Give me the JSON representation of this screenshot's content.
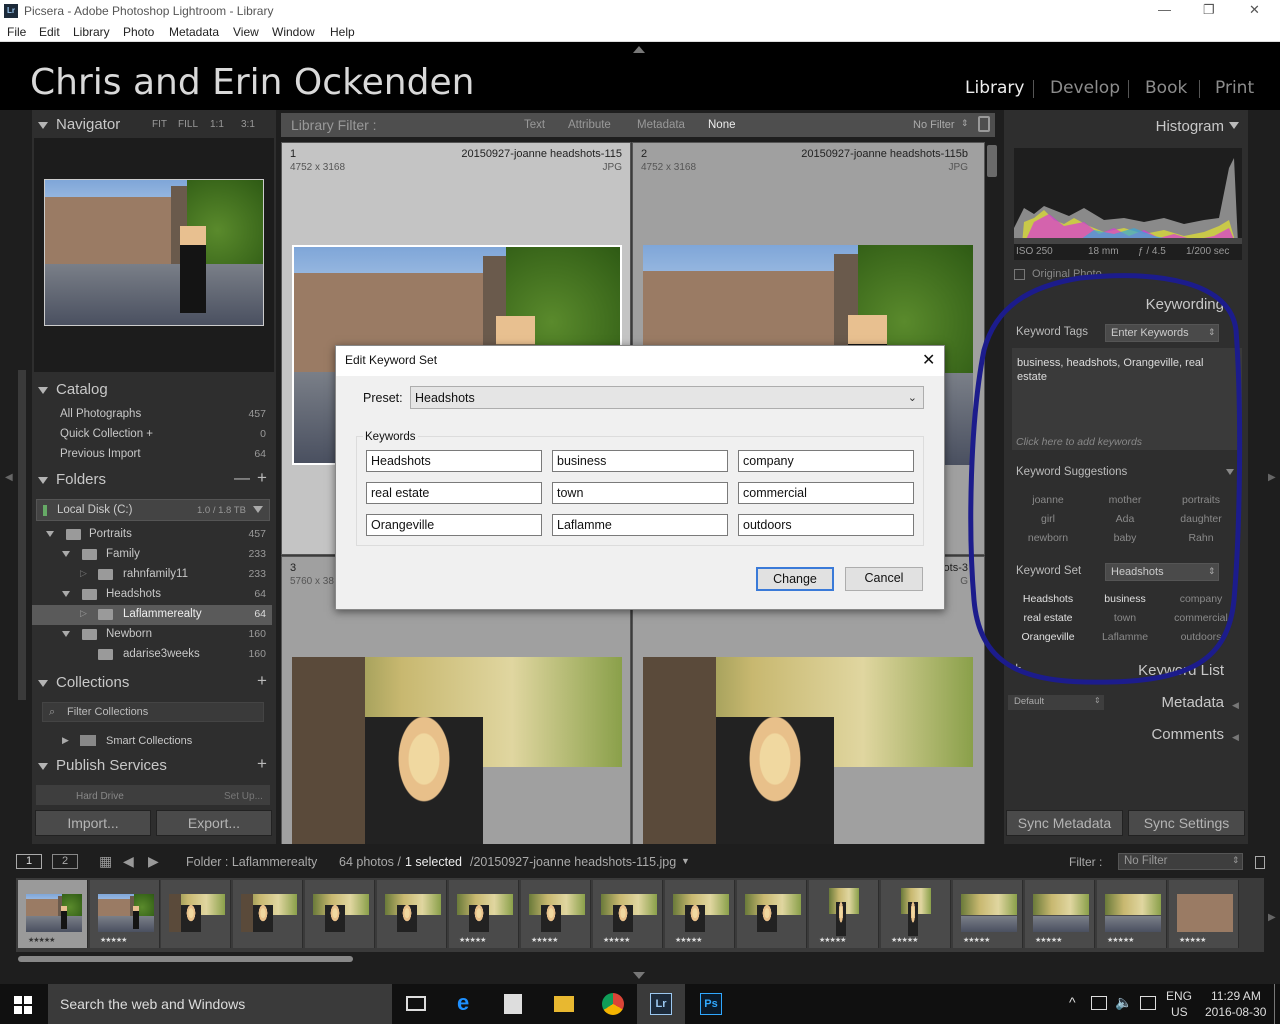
{
  "window": {
    "title": "Picsera - Adobe Photoshop Lightroom - Library",
    "app_badge": "Lr",
    "minimize": "—",
    "restore": "❐",
    "close": "✕"
  },
  "menu": [
    "File",
    "Edit",
    "Library",
    "Photo",
    "Metadata",
    "View",
    "Window",
    "Help"
  ],
  "identity_plate": "Chris and Erin Ockenden",
  "modules": [
    "Library",
    "Develop",
    "Book",
    "Print"
  ],
  "navigator": {
    "title": "Navigator",
    "zoom": [
      "FIT",
      "FILL",
      "1:1",
      "3:1"
    ]
  },
  "catalog": {
    "title": "Catalog",
    "items": [
      {
        "label": "All Photographs",
        "count": "457"
      },
      {
        "label": "Quick Collection  +",
        "count": "0"
      },
      {
        "label": "Previous Import",
        "count": "64"
      }
    ]
  },
  "folders": {
    "title": "Folders",
    "volume": "Local Disk (C:)",
    "volume_space": "1.0 / 1.8 TB",
    "items": [
      {
        "label": "Portraits",
        "count": "457"
      },
      {
        "label": "Family",
        "count": "233"
      },
      {
        "label": "rahnfamily11",
        "count": "233"
      },
      {
        "label": "Headshots",
        "count": "64"
      },
      {
        "label": "Laflammerealty",
        "count": "64"
      },
      {
        "label": "Newborn",
        "count": "160"
      },
      {
        "label": "adarise3weeks",
        "count": "160"
      }
    ]
  },
  "collections": {
    "title": "Collections",
    "filter": "Filter Collections",
    "smart": "Smart Collections"
  },
  "publish": {
    "title": "Publish Services",
    "hard_drive": "Hard Drive",
    "setup": "Set Up..."
  },
  "import_btn": "Import...",
  "export_btn": "Export...",
  "library_filter": {
    "label": "Library Filter :",
    "options": [
      "Text",
      "Attribute",
      "Metadata",
      "None"
    ],
    "preset": "No Filter"
  },
  "grid": {
    "cells": [
      {
        "index": "1",
        "filename": "20150927-joanne headshots-115",
        "dims": "4752 x 3168",
        "ext": "JPG"
      },
      {
        "index": "2",
        "filename": "20150927-joanne headshots-115b",
        "dims": "4752 x 3168",
        "ext": "JPG"
      },
      {
        "index": "3",
        "filename": "",
        "dims": "5760 x 38",
        "ext": ""
      },
      {
        "index": "",
        "filename": "hots-3",
        "dims": "",
        "ext": "G"
      }
    ]
  },
  "dialog": {
    "title": "Edit Keyword Set",
    "close": "✕",
    "preset_label": "Preset:",
    "preset_value": "Headshots",
    "keywords_label": "Keywords",
    "keywords": [
      "Headshots",
      "business",
      "company",
      "real estate",
      "town",
      "commercial",
      "Orangeville",
      "Laflamme",
      "outdoors"
    ],
    "change": "Change",
    "cancel": "Cancel"
  },
  "histogram": {
    "title": "Histogram",
    "iso": "ISO 250",
    "focal": "18 mm",
    "aperture": "ƒ / 4.5",
    "shutter": "1/200 sec",
    "original": "Original Photo"
  },
  "keywording": {
    "title": "Keywording",
    "tags_label": "Keyword Tags",
    "tags_mode": "Enter Keywords",
    "tags_text": "business, headshots, Orangeville, real estate",
    "add_hint": "Click here to add keywords",
    "suggestions_title": "Keyword Suggestions",
    "suggestions": [
      "joanne",
      "mother",
      "portraits",
      "girl",
      "Ada",
      "daughter",
      "newborn",
      "baby",
      "Rahn"
    ],
    "set_label": "Keyword Set",
    "set_value": "Headshots",
    "set": [
      "Headshots",
      "business",
      "company",
      "real estate",
      "town",
      "commercial",
      "Orangeville",
      "Laflamme",
      "outdoors"
    ]
  },
  "keyword_list": "Keyword List",
  "metadata": {
    "title": "Metadata",
    "preset": "Default"
  },
  "comments": "Comments",
  "sync_metadata": "Sync Metadata",
  "sync_settings": "Sync Settings",
  "filmbar": {
    "page1": "1",
    "page2": "2",
    "folder": "Folder : Laflammerealty",
    "count": "64 photos /",
    "selected": "1 selected",
    "file": "/20150927-joanne headshots-115.jpg",
    "filter_label": "Filter :",
    "filter_value": "No Filter"
  },
  "film_stars": "★★★★★",
  "taskbar": {
    "search": "Search the web and Windows",
    "lang1": "ENG",
    "lang2": "US",
    "time": "11:29 AM",
    "date": "2016-08-30"
  },
  "colors": {
    "annotation": "#1c1c8c",
    "accent": "#c8c8c8"
  }
}
